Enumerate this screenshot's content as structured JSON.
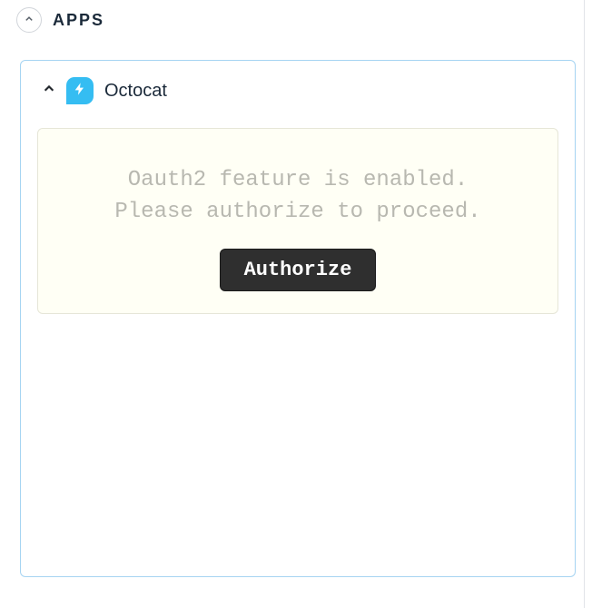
{
  "section": {
    "title": "APPS"
  },
  "card": {
    "app_name": "Octocat",
    "auth_message": "Oauth2 feature is enabled.\nPlease authorize to proceed.",
    "authorize_label": "Authorize"
  }
}
